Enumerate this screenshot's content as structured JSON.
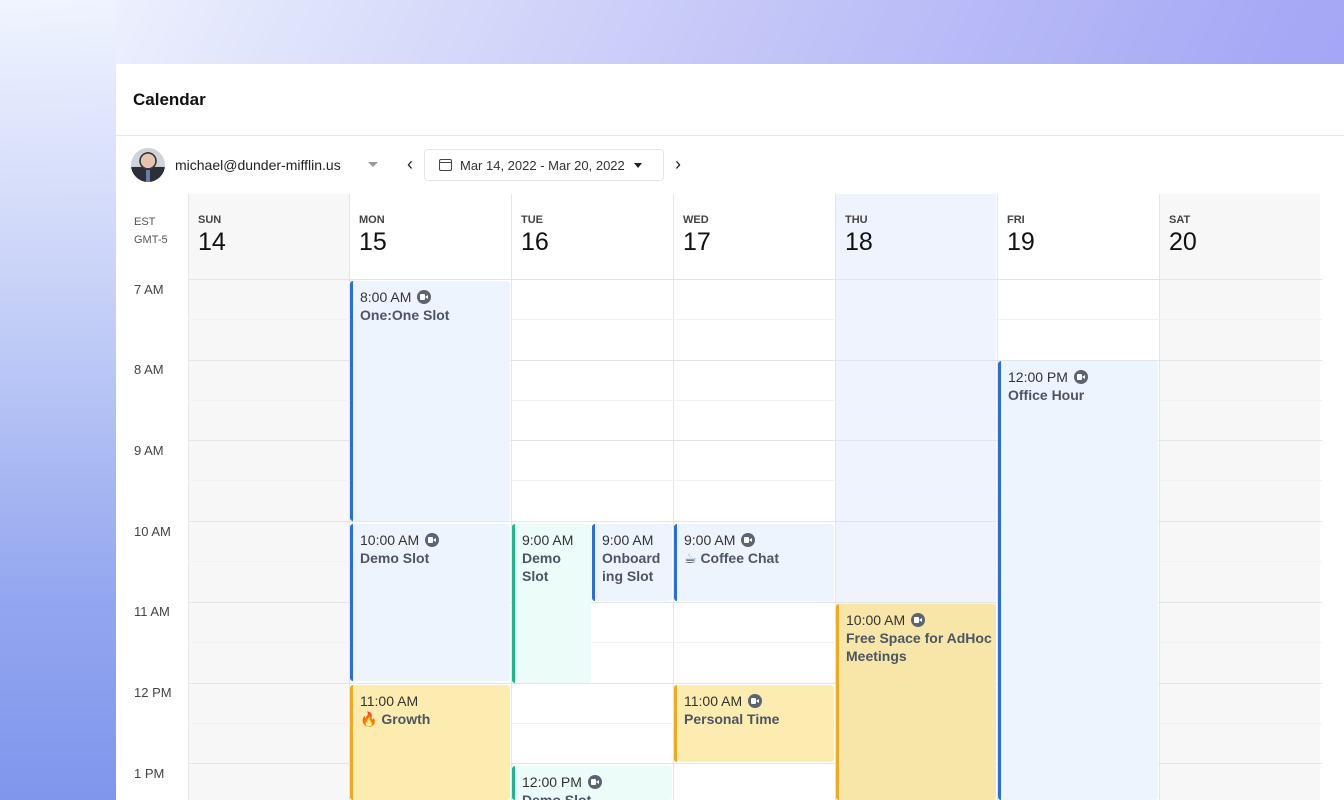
{
  "app": {
    "title": "Calendar"
  },
  "toolbar": {
    "account_email": "michael@dunder-mifflin.us",
    "prev_icon": "chevron-left-icon",
    "next_icon": "chevron-right-icon",
    "date_range": "Mar 14, 2022 - Mar 20, 2022"
  },
  "timezone": {
    "abbr": "EST",
    "offset": "GMT-5"
  },
  "hours": [
    "7 AM",
    "8 AM",
    "9 AM",
    "10 AM",
    "11 AM",
    "12 PM",
    "1 PM"
  ],
  "days": [
    {
      "name": "SUN",
      "num": "14"
    },
    {
      "name": "MON",
      "num": "15"
    },
    {
      "name": "TUE",
      "num": "16"
    },
    {
      "name": "WED",
      "num": "17"
    },
    {
      "name": "THU",
      "num": "18"
    },
    {
      "name": "FRI",
      "num": "19"
    },
    {
      "name": "SAT",
      "num": "20"
    }
  ],
  "colors": {
    "blue": "#2a6de0",
    "green": "#1bb98a",
    "yellow": "#f0aa21",
    "today_bg": "#eef3fd"
  },
  "events": [
    {
      "time": "8:00 AM",
      "title": "One:One Slot",
      "video": true
    },
    {
      "time": "12:00 PM",
      "title": "Office Hour",
      "video": true
    },
    {
      "time": "10:00 AM",
      "title": "Demo Slot",
      "video": true
    },
    {
      "time": "9:00 AM",
      "title": "Demo Slot",
      "video": false
    },
    {
      "time": "9:00 AM",
      "title": "Onboarding Slot",
      "video": false
    },
    {
      "time": "9:00 AM",
      "title": "☕ Coffee Chat",
      "video": true
    },
    {
      "time": "10:00 AM",
      "title": "Free Space for AdHoc Meetings",
      "video": true
    },
    {
      "time": "11:00 AM",
      "title": "🔥 Growth",
      "video": false
    },
    {
      "time": "11:00 AM",
      "title": "Personal Time",
      "video": true
    },
    {
      "time": "12:00 PM",
      "title": "Demo Slot",
      "video": true
    }
  ]
}
